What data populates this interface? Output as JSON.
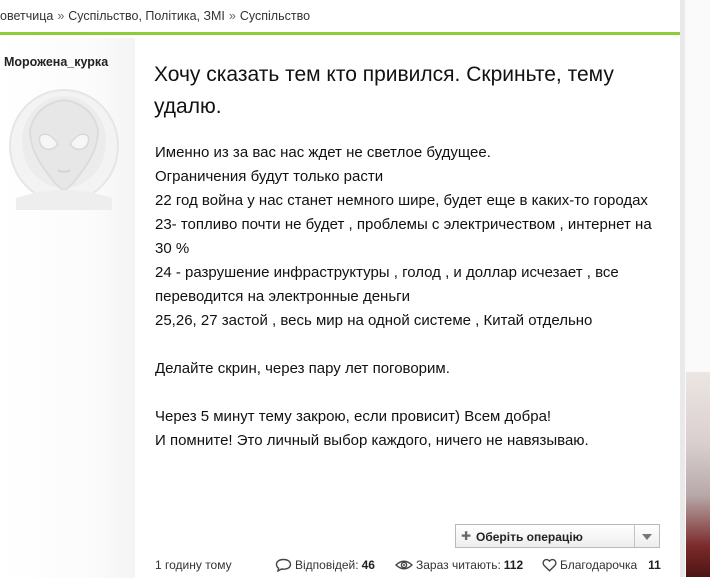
{
  "breadcrumb": {
    "items": [
      "оветчица",
      "Суспільство, Політика, ЗМІ",
      "Суспільство"
    ],
    "separator": "»"
  },
  "post": {
    "author": "Морожена_курка",
    "title": "Хочу сказать тем кто привился. Скриньте, тему удалю.",
    "body_lines": [
      "Именно из за вас нас ждет не светлое будущее.",
      "Ограничения будут только расти",
      "22 год война у нас станет немного шире, будет еще в каких-то городах",
      "23- топливо почти не будет , проблемы с электричеством , интернет на 30 %",
      "24 - разрушение инфраструктуры , голод , и доллар исчезает , все переводится на электронные деньги",
      "25,26, 27 застой , весь мир на одной системе , Китай отдельно",
      "",
      "Делайте скрин, через пару лет поговорим.",
      "",
      "Через 5 минут тему закрою, если провисит) Всем добра!",
      "И помните! Это личный выбор каждого, ничего не навязываю."
    ],
    "operations_label": "Оберіть операцію",
    "operations_icon": "plus-icon",
    "time": "1 годину тому",
    "replies_label": "Відповідей:",
    "replies_count": "46",
    "reading_label": "Зараз читають:",
    "reading_count": "112",
    "thanks_label": "Благодарочка",
    "thanks_count": "11"
  },
  "colors": {
    "accent": "#8dcc3a",
    "text": "#111111",
    "muted": "#333333"
  }
}
